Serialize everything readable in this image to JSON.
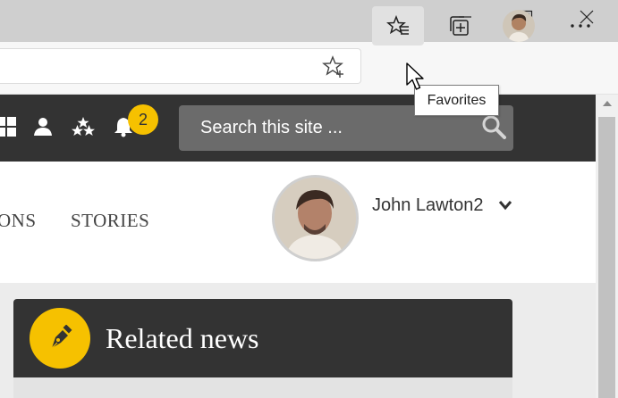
{
  "browser": {
    "tooltip": "Favorites",
    "icons": [
      "minimize-icon",
      "restore-icon",
      "close-icon",
      "star-add-icon",
      "favorites-icon",
      "collections-icon",
      "more-icon"
    ]
  },
  "site": {
    "notification_count": "2",
    "search_placeholder": "Search this site ...",
    "nav": [
      "ONS",
      "STORIES"
    ],
    "user_name": "John Lawton2",
    "related_title": "Related news"
  },
  "colors": {
    "header_bg": "#333333",
    "accent": "#f6c100",
    "search_bg": "#6b6b6b",
    "content_bg": "#ececec"
  }
}
